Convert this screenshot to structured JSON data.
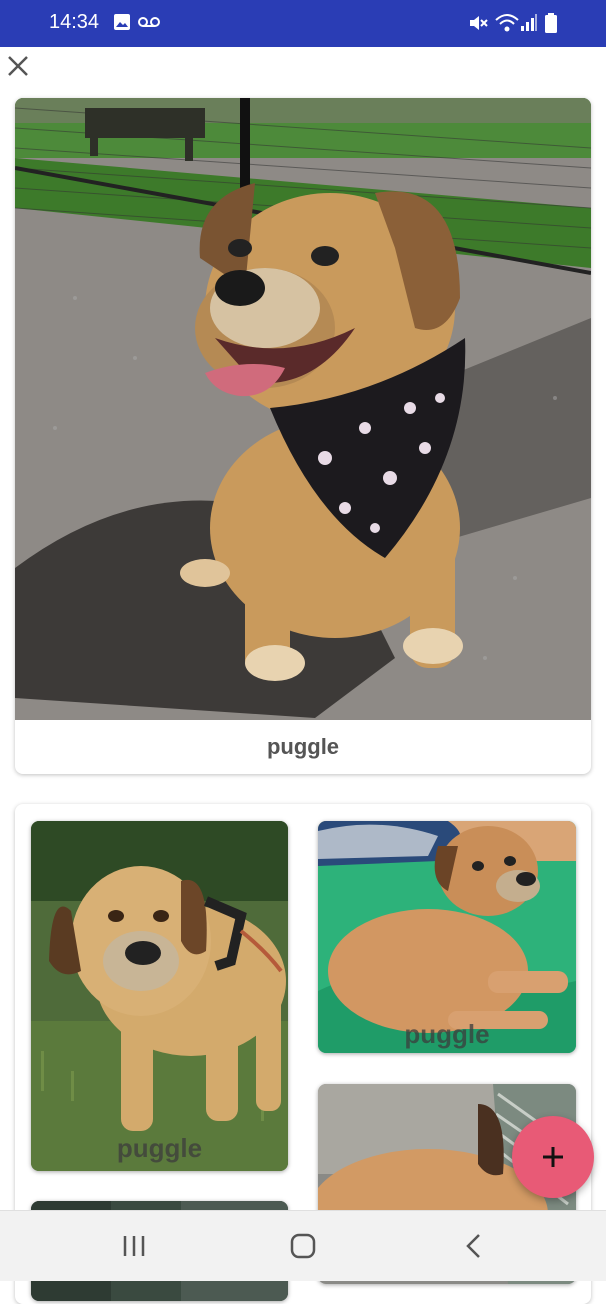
{
  "status_bar": {
    "time": "14:34",
    "icons": [
      "image-icon",
      "voicemail-icon",
      "mute-icon",
      "wifi-icon",
      "signal-icon",
      "battery-icon"
    ]
  },
  "header": {
    "close_icon": "close-icon"
  },
  "featured": {
    "caption": "puggle"
  },
  "grid": {
    "items": [
      {
        "caption": "puggle"
      },
      {
        "caption": "puggle"
      },
      {
        "caption": ""
      },
      {
        "caption": ""
      }
    ]
  },
  "fab": {
    "icon": "plus-icon"
  },
  "nav": {
    "buttons": [
      "recent-apps-icon",
      "home-icon",
      "back-icon"
    ]
  },
  "colors": {
    "status_bar": "#2a3db5",
    "fab": "#e85a76",
    "caption": "#555555"
  }
}
